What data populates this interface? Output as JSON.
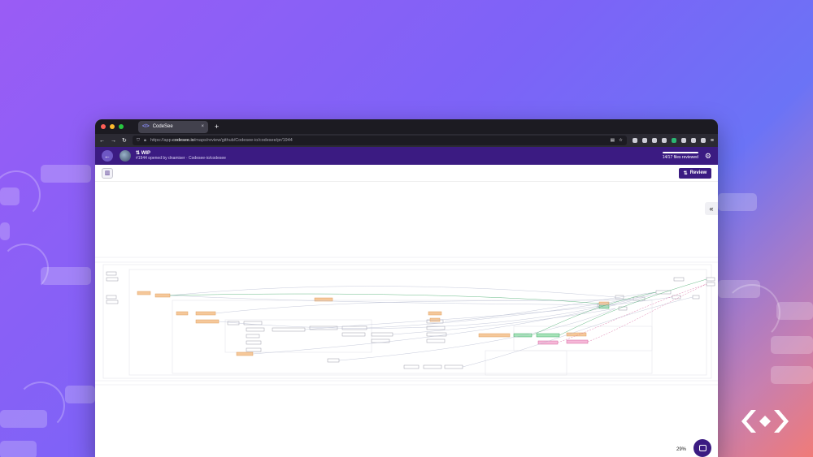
{
  "browser": {
    "tab_title": "CodeSee",
    "tab_close": "×",
    "new_tab": "+",
    "url_prefix": "https://app.",
    "url_domain": "codesee.io",
    "url_path": "/maps/review/github/Codesee-io/codesee/pr/1944"
  },
  "app": {
    "pr_title": "WIP",
    "pr_subtitle": "#1944 opened by dnamiser · Codesee-io/codesee",
    "files_reviewed": "14/17 files reviewed",
    "review_label": "Review",
    "zoom_level": "29%"
  },
  "colors": {
    "header": "#3b1b82",
    "changed_node": "#f5c89a",
    "added_node": "#a6e3b8",
    "removed_node": "#f5b8d8"
  },
  "icons": [
    "back-arrow-icon",
    "settings-icon",
    "sidebar-toggle-icon",
    "pull-request-icon",
    "collapse-icon",
    "chat-icon"
  ]
}
